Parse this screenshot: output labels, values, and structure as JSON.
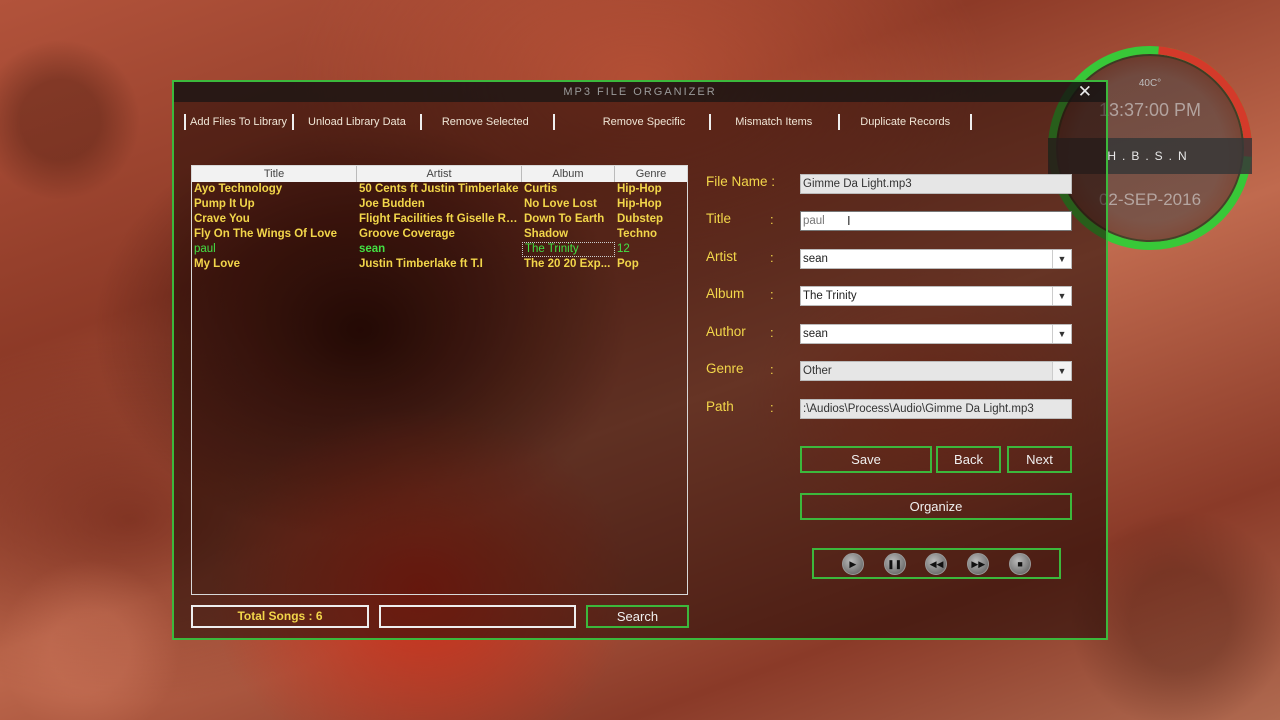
{
  "window": {
    "title": "MP3 FILE ORGANIZER",
    "close_label": "✕"
  },
  "menu": [
    {
      "label": "Add Files To Library"
    },
    {
      "label": "Unload Library Data"
    },
    {
      "label": "Remove Selected"
    },
    {
      "label": "Remove Specific"
    },
    {
      "label": "Mismatch Items"
    },
    {
      "label": "Duplicate Records"
    }
  ],
  "table": {
    "columns": [
      "Title",
      "Artist",
      "Album",
      "Genre"
    ],
    "rows": [
      [
        "Ayo Technology",
        "50 Cents ft Justin Timberlake",
        "Curtis",
        "Hip-Hop"
      ],
      [
        "Pump It Up",
        "Joe Budden",
        "No Love Lost",
        "Hip-Hop"
      ],
      [
        "Crave You",
        "Flight Facilities ft Giselle Ro...",
        "Down To Earth",
        "Dubstep"
      ],
      [
        "Fly On The Wings Of Love",
        "Groove Coverage",
        "Shadow",
        "Techno"
      ],
      [
        "paul",
        "sean",
        "The Trinity",
        "12"
      ],
      [
        "My Love",
        "Justin Timberlake ft T.I",
        "The 20 20 Exp...",
        "Pop"
      ]
    ],
    "selected_row": 4
  },
  "bottom": {
    "total_songs": "Total Songs : 6",
    "search_value": "",
    "search_button": "Search"
  },
  "form": {
    "file_name_label": "File Name :",
    "file_name_value": "Gimme Da Light.mp3",
    "title_label": "Title",
    "title_value": "paul",
    "artist_label": "Artist",
    "artist_value": "sean",
    "album_label": "Album",
    "album_value": "The Trinity",
    "author_label": "Author",
    "author_value": "sean",
    "genre_label": "Genre",
    "genre_value": "Other",
    "path_label": "Path",
    "path_value": ":\\Audios\\Process\\Audio\\Gimme Da Light.mp3",
    "colon": ":"
  },
  "buttons": {
    "save": "Save",
    "back": "Back",
    "next": "Next",
    "organize": "Organize"
  },
  "media_controls": [
    "play-icon",
    "pause-icon",
    "previous-icon",
    "next-icon",
    "stop-icon"
  ],
  "gadget": {
    "temperature": "40C°",
    "time": "13:37:00 PM",
    "name": "H.B.S.N",
    "date": "02-SEP-2016"
  },
  "colors": {
    "accent_green": "#3cb83c",
    "text_yellow": "#f2d64a",
    "selected_green": "#43e043"
  }
}
